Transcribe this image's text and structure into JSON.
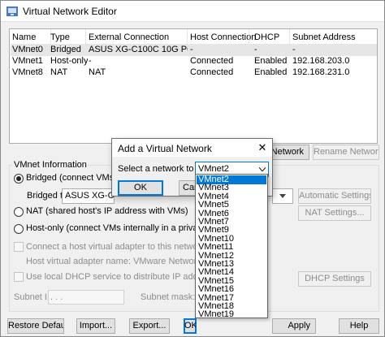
{
  "window": {
    "title": "Virtual Network Editor"
  },
  "table": {
    "headers": [
      "Name",
      "Type",
      "External Connection",
      "Host Connection",
      "DHCP",
      "Subnet Address"
    ],
    "rows": [
      [
        "VMnet0",
        "Bridged",
        "ASUS XG-C100C 10G PCI-E ...",
        "-",
        "-",
        "-"
      ],
      [
        "VMnet1",
        "Host-only",
        "-",
        "Connected",
        "Enabled",
        "192.168.203.0"
      ],
      [
        "VMnet8",
        "NAT",
        "NAT",
        "Connected",
        "Enabled",
        "192.168.231.0"
      ]
    ]
  },
  "buttons": {
    "add_network": "Network",
    "rename_network": "Rename Network...",
    "automatic_settings": "Automatic Settings...",
    "nat_settings": "NAT Settings...",
    "dhcp_settings": "DHCP Settings",
    "restore_defaults": "Restore Defaults",
    "import": "Import...",
    "export": "Export...",
    "ok": "OK",
    "cancel": "Cancel",
    "apply": "Apply",
    "help": "Help"
  },
  "vmnet_info": {
    "group_label": "VMnet Information",
    "bridged_label": "Bridged (connect VMs directly to the external network)",
    "bridged_to_label": "Bridged to:",
    "bridged_to_value": "ASUS XG-C100C 10G PCI-E Network Adapter",
    "nat_label": "NAT (shared host's IP address with VMs)",
    "hostonly_label": "Host-only (connect VMs internally in a private network)",
    "connect_adapter_label": "Connect a host virtual adapter to this network",
    "adapter_name_label": "Host virtual adapter name: VMware Network Adapter VMnet0",
    "use_dhcp_label": "Use local DHCP service to distribute IP address to VMs",
    "subnet_ip_label": "Subnet IP:",
    "subnet_ip_value": " .  .  .",
    "subnet_mask_label": "Subnet mask:"
  },
  "dialog": {
    "title": "Add a Virtual Network",
    "select_label": "Select a network to add:",
    "selected": "VMnet2",
    "ok": "OK",
    "cancel": "Cancel",
    "options": [
      "VMnet2",
      "VMnet3",
      "VMnet4",
      "VMnet5",
      "VMnet6",
      "VMnet7",
      "VMnet9",
      "VMnet10",
      "VMnet11",
      "VMnet12",
      "VMnet13",
      "VMnet14",
      "VMnet15",
      "VMnet16",
      "VMnet17",
      "VMnet18",
      "VMnet19"
    ]
  },
  "colors": {
    "selection": "#0078d7",
    "window_bg": "#f0f0f0",
    "selected_row": "#e6e6e6"
  }
}
